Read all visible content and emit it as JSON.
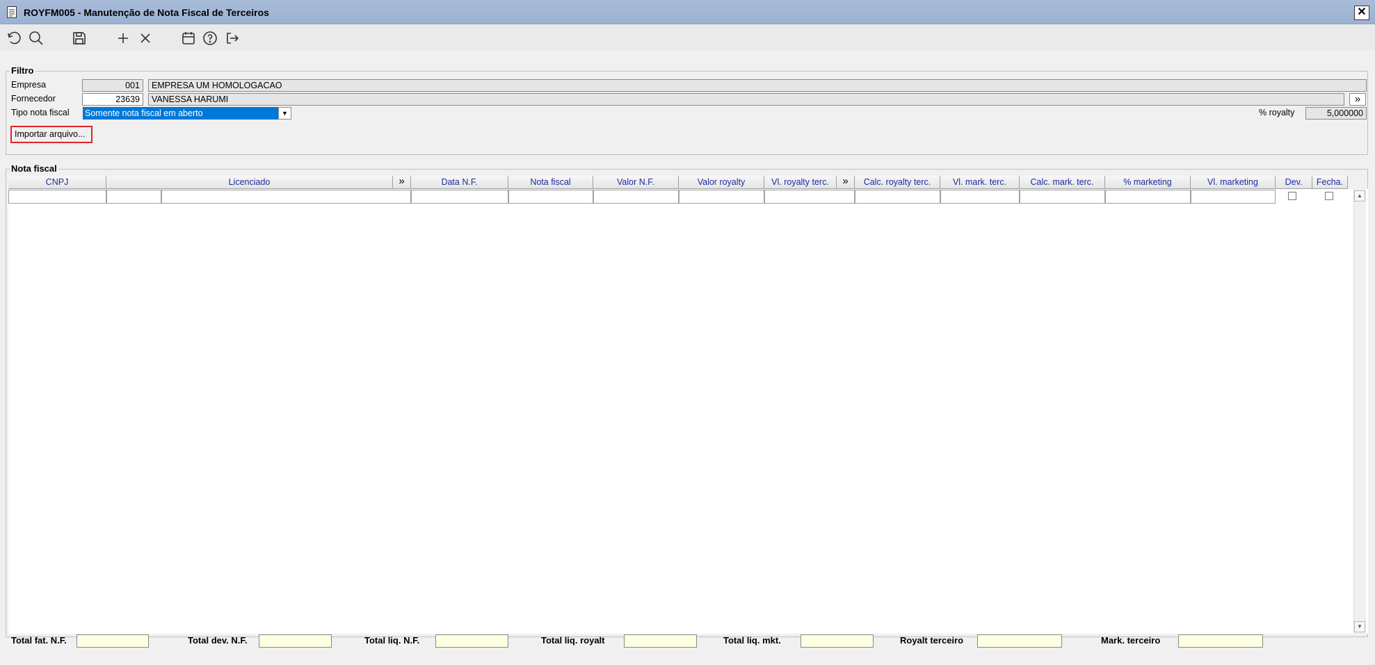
{
  "window": {
    "title": "ROYFM005 - Manutenção de Nota Fiscal de Terceiros",
    "close_glyph": "✕"
  },
  "toolbar": {
    "icons": [
      "refresh-icon",
      "search-icon",
      "save-icon",
      "add-icon",
      "delete-icon",
      "calendar-icon",
      "help-icon",
      "exit-icon"
    ]
  },
  "filtro": {
    "legend": "Filtro",
    "empresa_label": "Empresa",
    "empresa_code": "001",
    "empresa_name": "EMPRESA UM HOMOLOGACAO",
    "fornecedor_label": "Fornecedor",
    "fornecedor_code": "23639",
    "fornecedor_name": "VANESSA HARUMI",
    "tipo_label": "Tipo nota fiscal",
    "tipo_value": "Somente nota fiscal em aberto",
    "royalty_label": "% royalty",
    "royalty_value": "5,000000",
    "import_button": "Importar arquivo..."
  },
  "nota_fiscal": {
    "legend": "Nota fiscal",
    "columns": {
      "cnpj": "CNPJ",
      "licenciado": "Licenciado",
      "data_nf": "Data N.F.",
      "nota_fiscal": "Nota fiscal",
      "valor_nf": "Valor N.F.",
      "valor_royalty": "Valor royalty",
      "vl_royalty_terc": "Vl. royalty terc.",
      "calc_royalty_terc": "Calc. royalty terc.",
      "vl_mark_terc": "Vl. mark. terc.",
      "calc_mark_terc": "Calc. mark. terc.",
      "pct_marketing": "% marketing",
      "vl_marketing": "Vl. marketing",
      "dev": "Dev.",
      "fecha": "Fecha."
    },
    "expand_glyph": "»"
  },
  "totals": {
    "total_fat_nf": "Total fat. N.F.",
    "total_dev_nf": "Total dev. N.F.",
    "total_liq_nf": "Total liq. N.F.",
    "total_liq_royalt": "Total liq. royalt",
    "total_liq_mkt": "Total liq. mkt.",
    "royalt_terceiro": "Royalt terceiro",
    "mark_terceiro": "Mark. terceiro"
  }
}
